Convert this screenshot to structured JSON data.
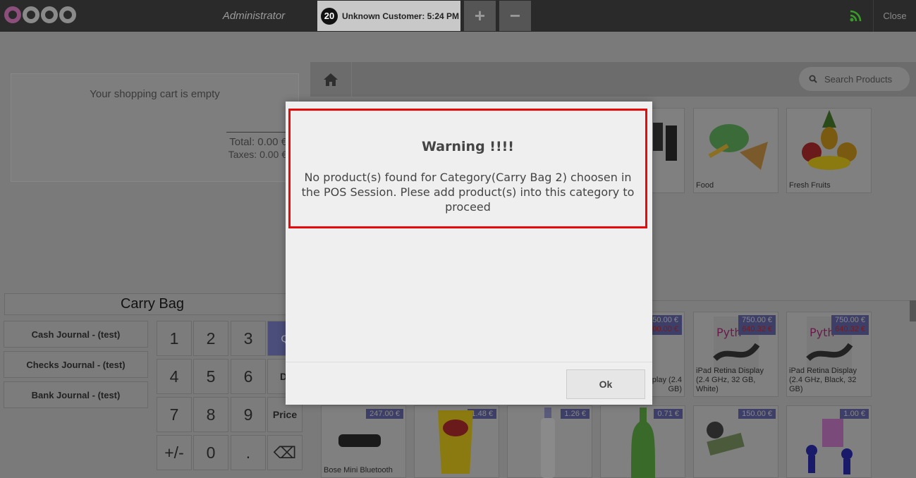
{
  "topbar": {
    "user": "Administrator",
    "order_number": "20",
    "order_label": "Unknown Customer: 5:24 PM",
    "add_label": "+",
    "remove_label": "−",
    "close_label": "Close"
  },
  "cart": {
    "empty": "Your shopping cart is empty",
    "total": "Total: 0.00 €",
    "taxes": "Taxes: 0.00 €"
  },
  "carry_bag": "Carry Bag",
  "journals": [
    "Cash Journal - (test)",
    "Checks Journal - (test)",
    "Bank Journal - (test)"
  ],
  "numpad": {
    "k1": "1",
    "k2": "2",
    "k3": "3",
    "qty": "Q",
    "k4": "4",
    "k5": "5",
    "k6": "6",
    "disc": "Di",
    "k7": "7",
    "k8": "8",
    "k9": "9",
    "price": "Price",
    "plusminus": "+/-",
    "k0": "0",
    "dot": ".",
    "backspace": "⌫"
  },
  "search": {
    "placeholder": "Search Products"
  },
  "categories": [
    {
      "name": "Food"
    },
    {
      "name": "Fresh Fruits"
    }
  ],
  "products_row1": [
    {
      "name": "splay (2.4\nGB)",
      "old": "750.00 €",
      "new": "600.00 €"
    },
    {
      "name": "iPad Retina Display (2.4 GHz, 32 GB, White)",
      "old": "750.00 €",
      "new": "640.32 €"
    },
    {
      "name": "iPad Retina Display (2.4 GHz, Black, 32 GB)",
      "old": "750.00 €",
      "new": "640.32 €"
    }
  ],
  "products_row2": [
    {
      "name": "Bose Mini Bluetooth",
      "price": "247.00 €"
    },
    {
      "name": "",
      "price": "1.48 €"
    },
    {
      "name": "",
      "price": "1.26 €"
    },
    {
      "name": "",
      "price": "0.71 €"
    },
    {
      "name": "",
      "price": "150.00 €"
    },
    {
      "name": "",
      "price": "1.00 €"
    }
  ],
  "modal": {
    "title": "Warning !!!!",
    "body": "No product(s) found for Category(Carry Bag 2) choosen in the POS Session. Plese add product(s) into this category to proceed",
    "ok": "Ok"
  }
}
